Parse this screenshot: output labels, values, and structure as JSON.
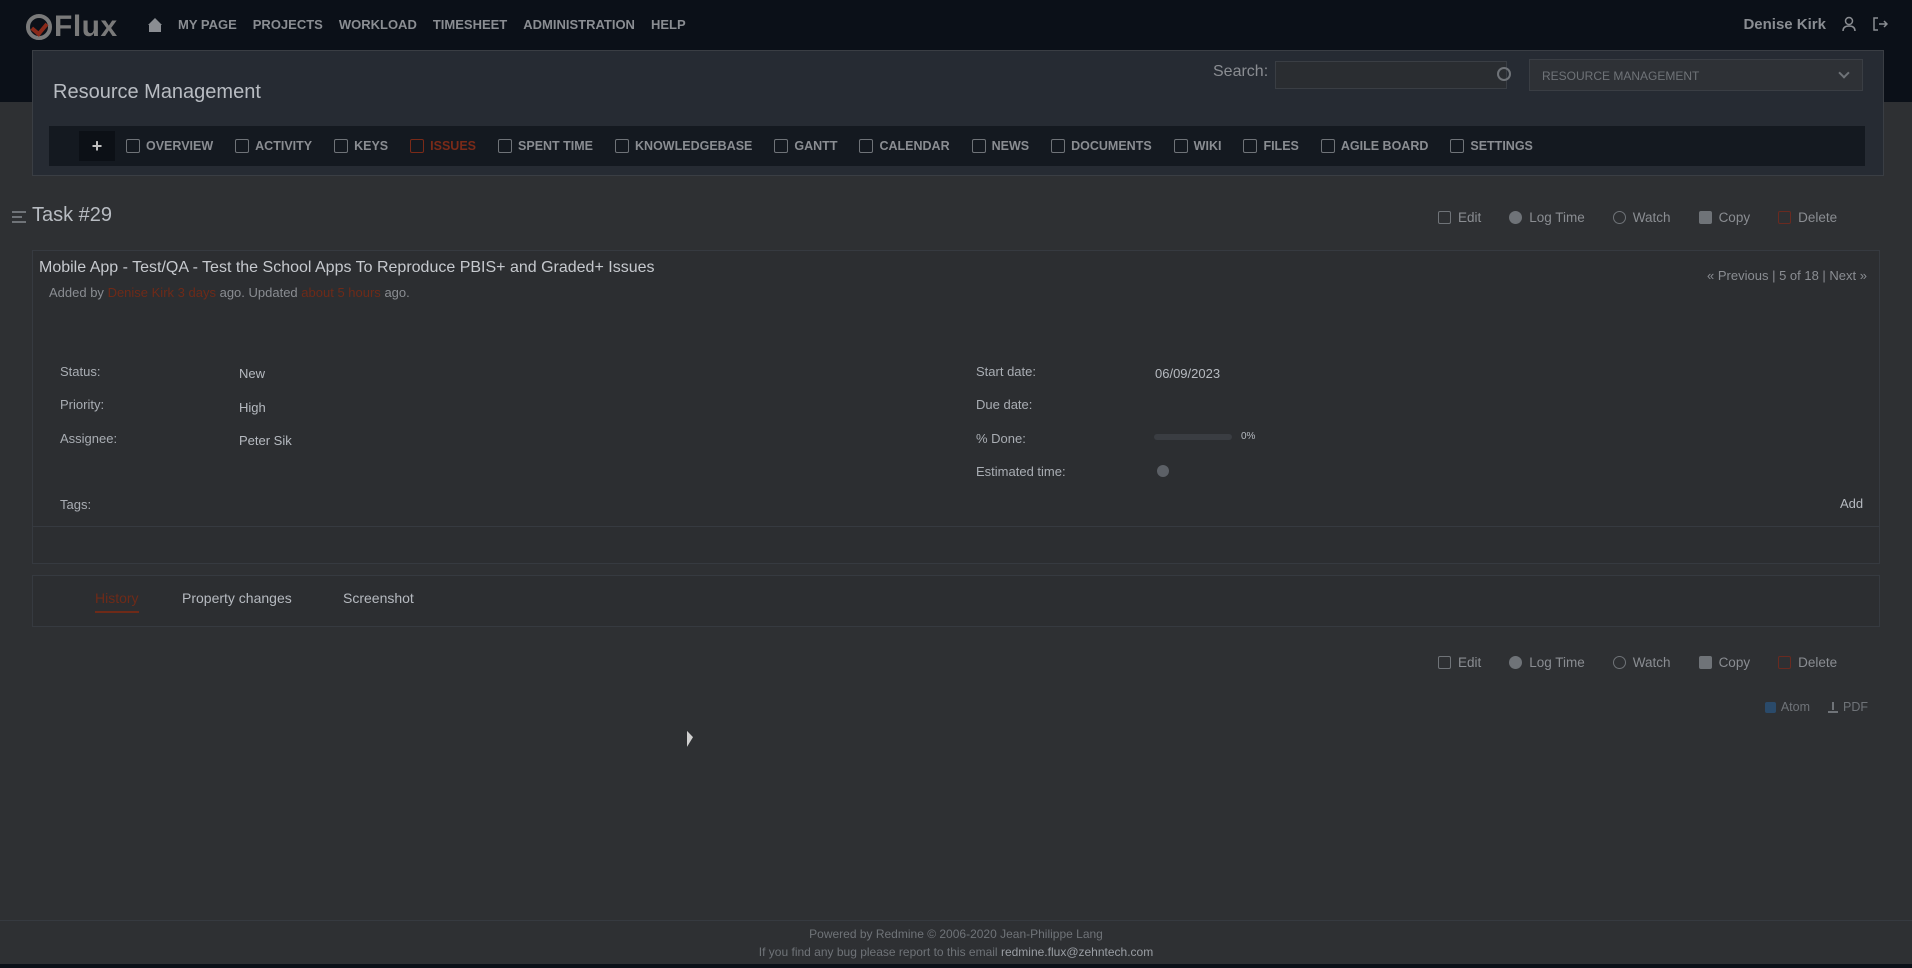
{
  "app": {
    "logo_text": "Flux"
  },
  "topnav": {
    "items": [
      "MY PAGE",
      "PROJECTS",
      "WORKLOAD",
      "TIMESHEET",
      "ADMINISTRATION",
      "HELP"
    ],
    "user_name": "Denise Kirk"
  },
  "project": {
    "title": "Resource Management",
    "search_label": "Search:",
    "search_placeholder": "",
    "selector_value": "RESOURCE MANAGEMENT"
  },
  "tabs": {
    "new_label": "+",
    "items": [
      {
        "label": "OVERVIEW",
        "icon": "overview-icon"
      },
      {
        "label": "ACTIVITY",
        "icon": "activity-icon"
      },
      {
        "label": "KEYS",
        "icon": "shield-icon"
      },
      {
        "label": "ISSUES",
        "icon": "issues-icon",
        "active": true
      },
      {
        "label": "SPENT TIME",
        "icon": "clock-icon"
      },
      {
        "label": "KNOWLEDGEBASE",
        "icon": "knowledgebase-icon"
      },
      {
        "label": "GANTT",
        "icon": "gantt-icon"
      },
      {
        "label": "CALENDAR",
        "icon": "calendar-icon"
      },
      {
        "label": "NEWS",
        "icon": "news-icon"
      },
      {
        "label": "DOCUMENTS",
        "icon": "documents-icon"
      },
      {
        "label": "WIKI",
        "icon": "wiki-icon"
      },
      {
        "label": "FILES",
        "icon": "files-icon"
      },
      {
        "label": "AGILE BOARD",
        "icon": "agile-board-icon"
      },
      {
        "label": "SETTINGS",
        "icon": "gear-icon"
      }
    ],
    "accent_color": "#7a2a18"
  },
  "issue": {
    "heading": "Task #29",
    "actions": {
      "edit": "Edit",
      "log_time": "Log Time",
      "watch": "Watch",
      "copy": "Copy",
      "delete": "Delete"
    },
    "subject": "Mobile App - Test/QA - Test the School Apps To Reproduce PBIS+ and Graded+ Issues",
    "meta": {
      "added_by_prefix": "Added by",
      "author": "Denise Kirk",
      "created_ago": "3 days",
      "updated_prefix": "ago. Updated",
      "updated_ago": "about 5 hours",
      "suffix": "ago."
    },
    "pager": "« Previous | 5 of 18 | Next »",
    "attributes": {
      "status_label": "Status:",
      "status": "New",
      "priority_label": "Priority:",
      "priority": "High",
      "assignee_label": "Assignee:",
      "assignee": "Peter Sik",
      "start_date_label": "Start date:",
      "start_date": "06/09/2023",
      "due_date_label": "Due date:",
      "due_date": "",
      "done_label": "% Done:",
      "done_value": "0%",
      "done_fraction": 0,
      "estimated_label": "Estimated time:",
      "tags_label": "Tags:",
      "tags_add": "Add"
    }
  },
  "history_tabs": {
    "history": "History",
    "property_changes": "Property changes",
    "screenshot": "Screenshot"
  },
  "feeds": {
    "atom": "Atom",
    "pdf": "PDF"
  },
  "footer": {
    "line1": "Powered by Redmine © 2006-2020 Jean-Philippe Lang",
    "line2": "If you find any bug please report to this email",
    "email": "redmine.flux@zehntech.com"
  }
}
